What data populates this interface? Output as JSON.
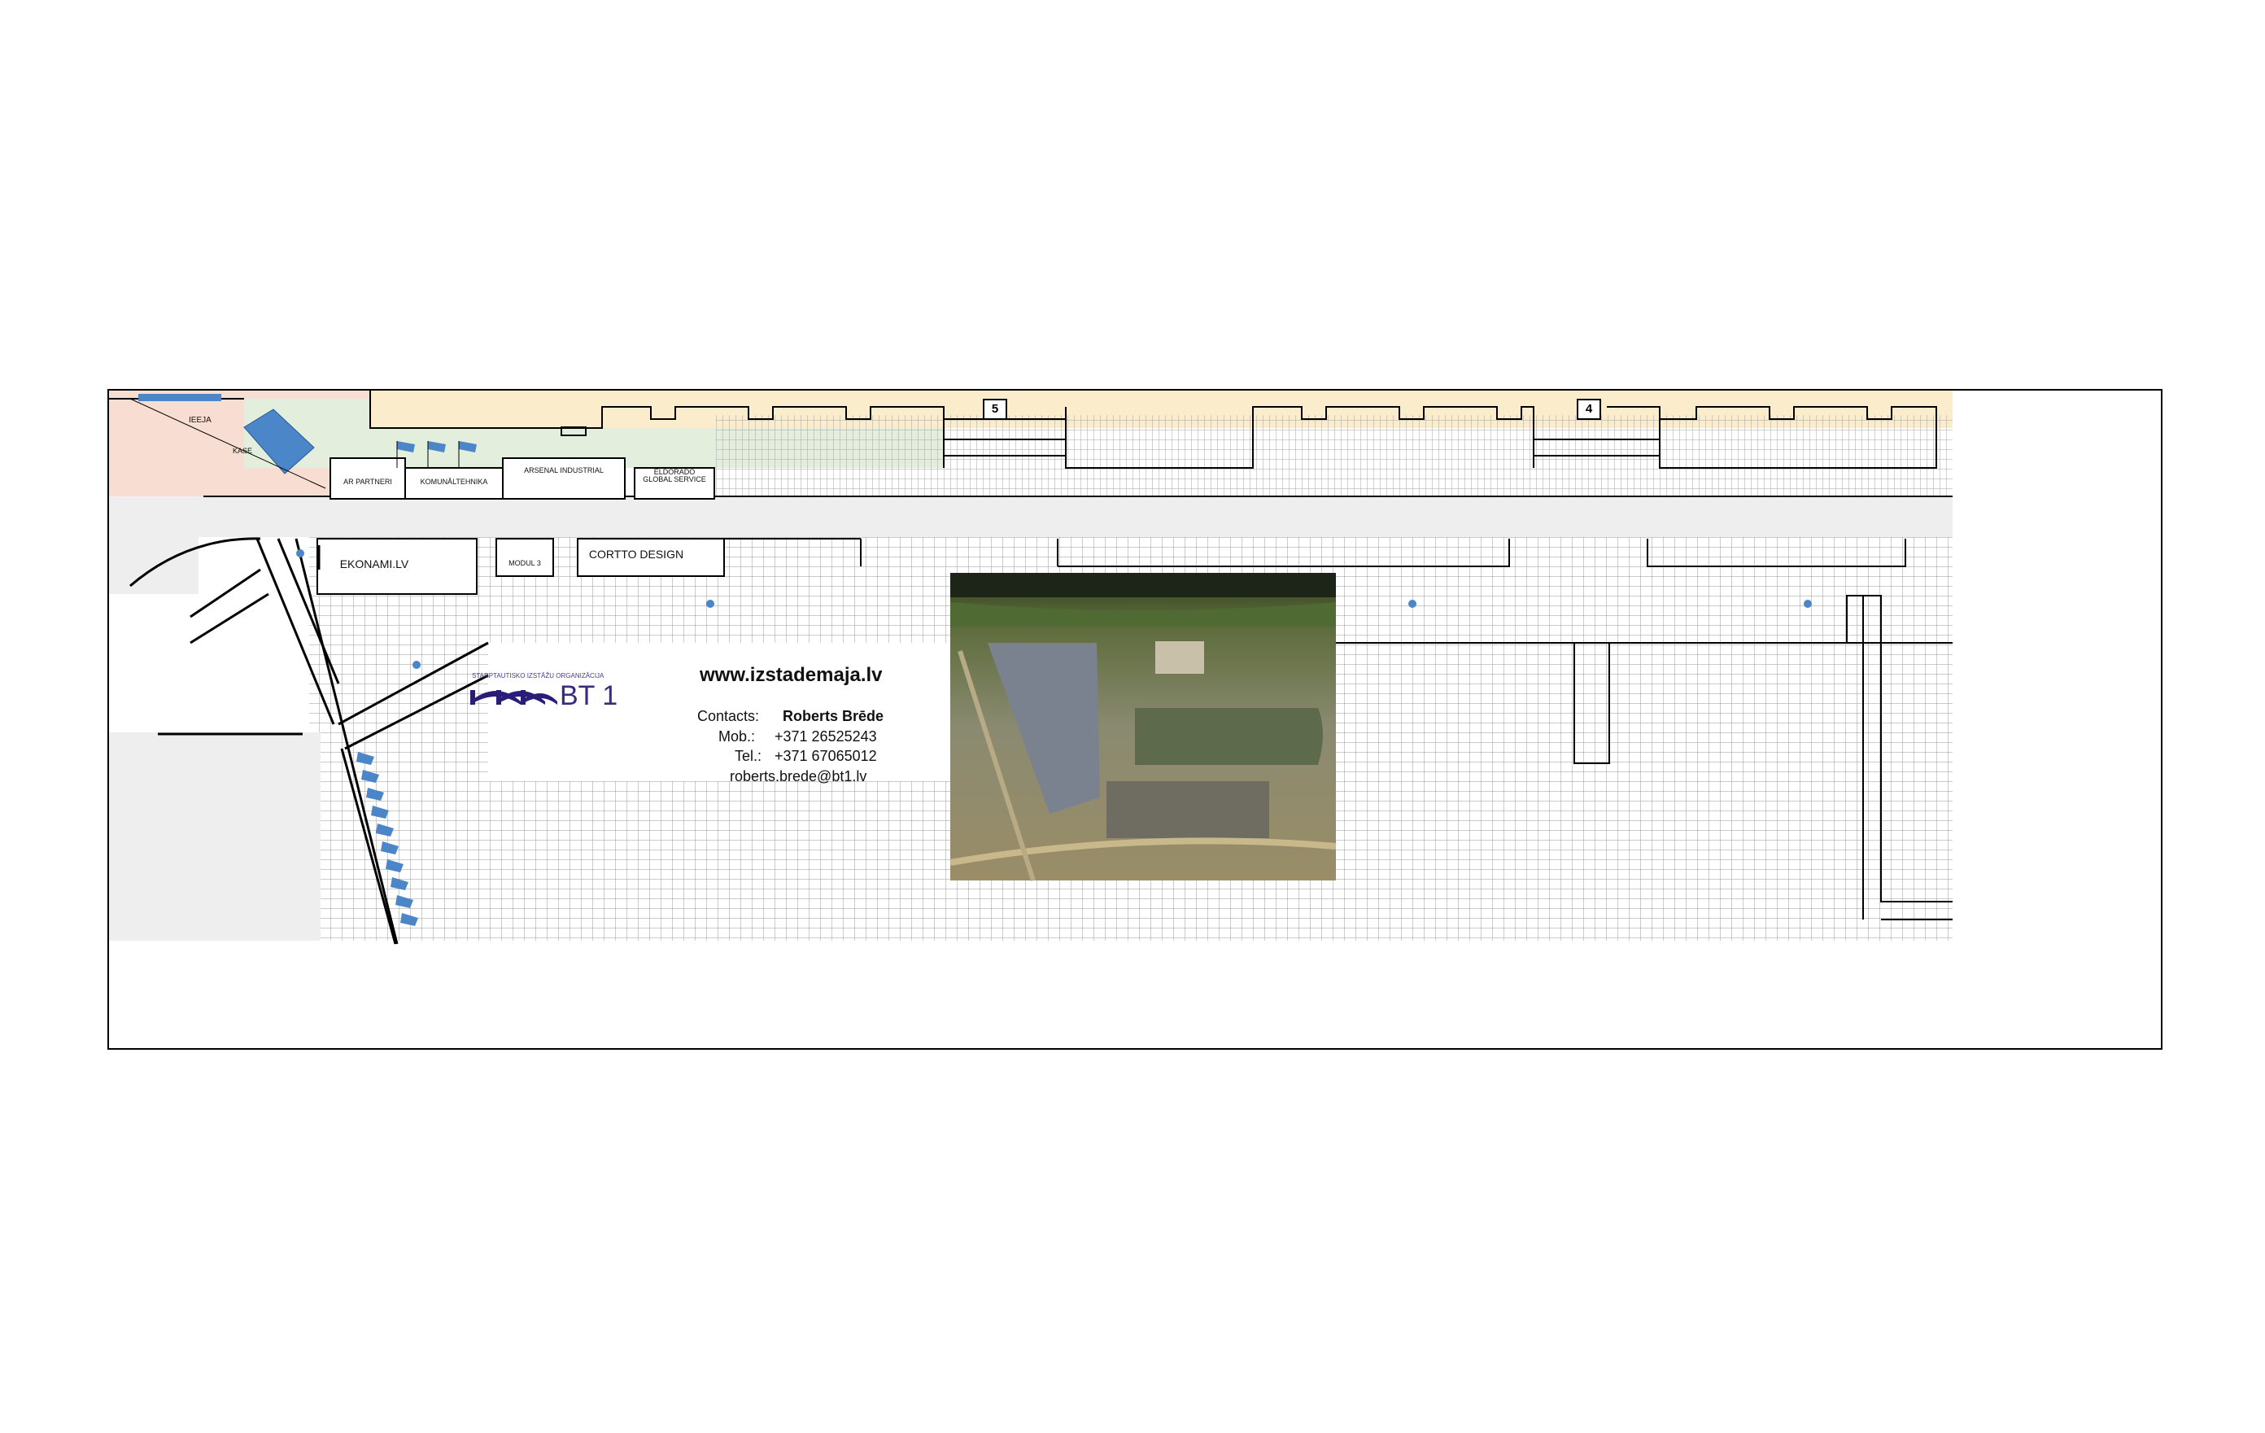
{
  "map": {
    "labels": {
      "entrance": "IEEJA",
      "cashier": "KASE",
      "ar_partneri": "AR PARTNERI",
      "komunaltehnika": "KOMUNĀLTEHNIKA",
      "arsenal": "ARSENAL INDUSTRIAL",
      "eldorado": "ELDORADO GLOBAL SERVICE",
      "ekonami": "EKONAMI.LV",
      "modul3": "MODUL 3",
      "cortto": "CORTTO DESIGN"
    },
    "gate_numbers": [
      "5",
      "4"
    ],
    "colors": {
      "top_strip": "#fbeccc",
      "entry_zone": "#f8ddd2",
      "green_zone": "#e3efdc",
      "road": "#eeeeee",
      "flag": "#4a86c8",
      "grid_line": "#9a9a9a"
    }
  },
  "contact": {
    "website": "www.izstademaja.lv",
    "contacts_label": "Contacts:",
    "contact_name": "Roberts Brēde",
    "mob_label": "Mob.:",
    "mob_value": "+371 26525243",
    "tel_label": "Tel.:",
    "tel_value": "+371 67065012",
    "email": "roberts.brede@bt1.lv"
  },
  "logo": {
    "text": "BT 1",
    "subtitle": "STARPTAUTISKO IZSTĀŽU ORGANIZĀCIJA"
  }
}
